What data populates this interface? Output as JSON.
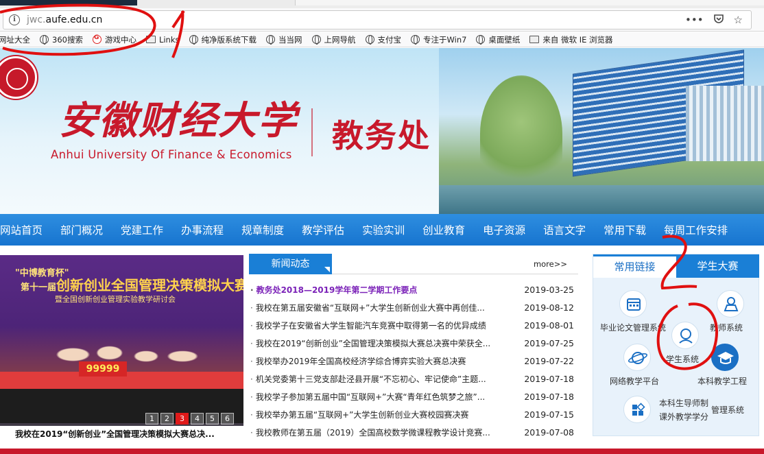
{
  "browser": {
    "url_prefix": "jwc.",
    "url_domain": "aufe.edu.cn",
    "bookmarks": [
      {
        "label": "网址大全",
        "icon": "none"
      },
      {
        "label": "360搜索",
        "icon": "globe-icon"
      },
      {
        "label": "游戏中心",
        "icon": "game-icon"
      },
      {
        "label": "Links",
        "icon": "folder-icon"
      },
      {
        "label": "纯净版系统下载",
        "icon": "globe-icon"
      },
      {
        "label": "当当网",
        "icon": "globe-icon"
      },
      {
        "label": "上网导航",
        "icon": "globe-icon"
      },
      {
        "label": "支付宝",
        "icon": "globe-icon"
      },
      {
        "label": "专注于Win7",
        "icon": "globe-icon"
      },
      {
        "label": "桌面壁纸",
        "icon": "globe-icon"
      },
      {
        "label": "来自 微软 IE 浏览器",
        "icon": "folder-icon"
      }
    ]
  },
  "header": {
    "university_cn": "安徽财经大学",
    "university_en": "Anhui University Of Finance & Economics",
    "office": "教务处"
  },
  "nav": {
    "items": [
      "网站首页",
      "部门概况",
      "党建工作",
      "办事流程",
      "规章制度",
      "教学评估",
      "实验实训",
      "创业教育",
      "电子资源",
      "语言文字",
      "常用下载",
      "每周工作安排"
    ]
  },
  "slideshow": {
    "banner_line1": "\"中博教育杯\"",
    "banner_line2_prefix": "第十一届",
    "banner_line2": "创新创业全国管理决策模拟大赛总决赛",
    "banner_line3": "暨全国创新创业管理实验教学研讨会",
    "prize": "99999",
    "pages": [
      "1",
      "2",
      "3",
      "4",
      "5",
      "6"
    ],
    "active_page": "3",
    "caption": "我校在2019“创新创业”全国管理决策模拟大赛总决..."
  },
  "news": {
    "tab_label": "新闻动态",
    "more_label": "more>>",
    "items": [
      {
        "title": "教务处2018—2019学年第二学期工作要点",
        "date": "2019-03-25",
        "highlight": true
      },
      {
        "title": "我校在第五届安徽省“互联网+”大学生创新创业大赛中再创佳...",
        "date": "2019-08-12",
        "highlight": false
      },
      {
        "title": "我校学子在安徽省大学生智能汽车竞赛中取得第一名的优异成绩",
        "date": "2019-08-01",
        "highlight": false
      },
      {
        "title": "我校在2019“创新创业”全国管理决策模拟大赛总决赛中荣获全...",
        "date": "2019-07-25",
        "highlight": false
      },
      {
        "title": "我校举办2019年全国高校经济学综合博弈实验大赛总决赛",
        "date": "2019-07-22",
        "highlight": false
      },
      {
        "title": "机关党委第十三党支部赴泾县开展“不忘初心、牢记使命”主题...",
        "date": "2019-07-18",
        "highlight": false
      },
      {
        "title": "我校学子参加第五届中国“互联网+”大赛“青年红色筑梦之旅”...",
        "date": "2019-07-18",
        "highlight": false
      },
      {
        "title": "我校举办第五届“互联网+”大学生创新创业大赛校园赛决赛",
        "date": "2019-07-15",
        "highlight": false
      },
      {
        "title": "我校教师在第五届（2019）全国高校数学微课程教学设计竞赛...",
        "date": "2019-07-08",
        "highlight": false
      }
    ]
  },
  "links_panel": {
    "tab_active": "常用链接",
    "tab_inactive": "学生大赛",
    "systems": {
      "thesis": "毕业论文管理系统",
      "teacher": "教师系统",
      "student": "学生系统",
      "network": "网络教学平台",
      "undergrad_project": "本科教学工程",
      "mentor_line1": "本科生导师制",
      "mentor_line2": "课外教学学分",
      "mentor_suffix": "管理系统"
    }
  }
}
